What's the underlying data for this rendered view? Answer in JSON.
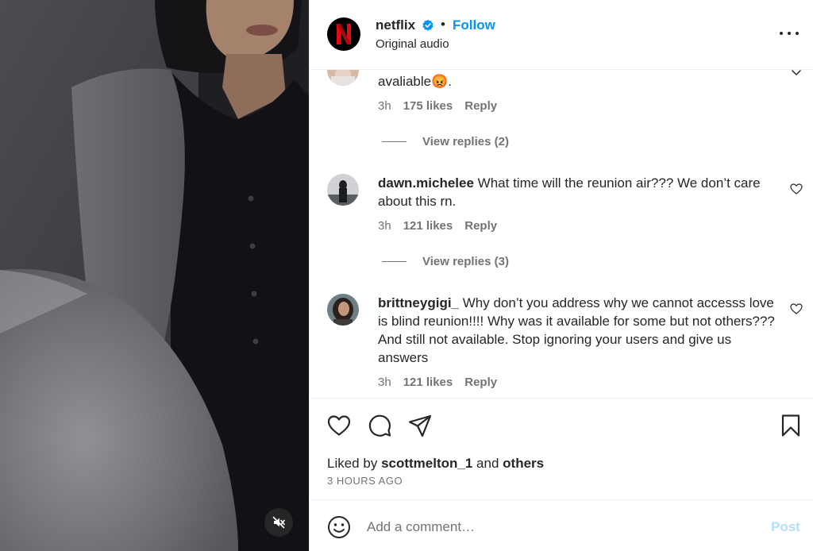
{
  "post": {
    "account": "netflix",
    "separator": "•",
    "follow_label": "Follow",
    "audio_label": "Original audio"
  },
  "comments": [
    {
      "text": "avaliable😡.",
      "time": "3h",
      "likes": "175 likes",
      "reply_label": "Reply",
      "view_replies": "View replies (2)"
    },
    {
      "username": "dawn.michelee",
      "text": "What time will the reunion air??? We don’t care about this rn.",
      "time": "3h",
      "likes": "121 likes",
      "reply_label": "Reply",
      "view_replies": "View replies (3)"
    },
    {
      "username": "brittneygigi_",
      "text": "Why don’t you address why we cannot accesss love is blind reunion!!!! Why was it available for some but not others??? And still not available. Stop ignoring your users and give us answers",
      "time": "3h",
      "likes": "121 likes",
      "reply_label": "Reply"
    }
  ],
  "engagement": {
    "liked_by_prefix": "Liked by",
    "liked_by_user": "scottmelton_1",
    "liked_by_and": "and",
    "liked_by_others": "others",
    "time_ago": "3 HOURS AGO"
  },
  "comment_box": {
    "placeholder": "Add a comment…",
    "post_label": "Post"
  },
  "icons": {
    "header": [
      "netflix-logo",
      "verified-badge-icon",
      "more-options-icon"
    ],
    "actions": [
      "heart-icon",
      "comment-icon",
      "share-icon",
      "bookmark-icon"
    ],
    "media": [
      "mute-icon"
    ],
    "comment_box": [
      "emoji-icon"
    ]
  },
  "colors": {
    "link_blue": "#0095f6",
    "post_disabled": "#b2dffc",
    "netflix_red": "#e50914",
    "secondary_text": "#737373"
  }
}
